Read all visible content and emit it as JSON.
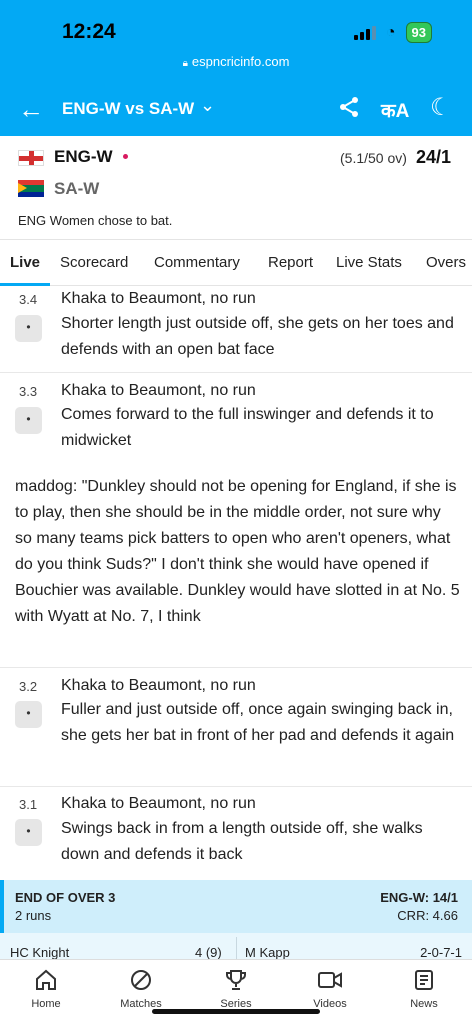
{
  "status": {
    "time": "12:24",
    "battery": "93"
  },
  "url": "espncricinfo.com",
  "header": {
    "title": "ENG-W vs SA-W"
  },
  "score": {
    "team1": "ENG-W",
    "team2": "SA-W",
    "overs": "(5.1/50 ov)",
    "runs": "24/1",
    "toss": "ENG Women chose to bat."
  },
  "tabs": [
    "Live",
    "Scorecard",
    "Commentary",
    "Report",
    "Live Stats",
    "Overs"
  ],
  "balls": [
    {
      "num": "3.4",
      "chip": "•",
      "head": "Khaka to Beaumont, no run",
      "text": "Shorter length just outside off, she gets on her toes and defends with an open bat face"
    },
    {
      "num": "3.3",
      "chip": "•",
      "head": "Khaka to Beaumont, no run",
      "text": "Comes forward to the full inswinger and defends it to midwicket"
    },
    {
      "num": "3.2",
      "chip": "•",
      "head": "Khaka to Beaumont, no run",
      "text": "Fuller and just outside off, once again swinging back in, she gets her bat in front of her pad and defends it again"
    },
    {
      "num": "3.1",
      "chip": "•",
      "head": "Khaka to Beaumont, no run",
      "text": "Swings back in from a length outside off, she walks down and defends it back"
    }
  ],
  "note": "maddog: \"Dunkley should not be opening for England, if she is to play, then she should be in the middle order, not sure why so many teams pick batters to open who aren't openers, what do you think Suds?\" I don't think she would have opened if Bouchier was available. Dunkley would have slotted in at No. 5 with Wyatt at No. 7, I think",
  "over": {
    "title": "END OF OVER 3",
    "runs": "2 runs",
    "score": "ENG-W: 14/1",
    "crr": "CRR: 4.66",
    "batter": "HC Knight",
    "batter_fig": "4 (9)",
    "bowler": "M Kapp",
    "bowler_fig": "2-0-7-1"
  },
  "nav": [
    {
      "label": "Home",
      "icon": "home-icon"
    },
    {
      "label": "Matches",
      "icon": "ball-icon"
    },
    {
      "label": "Series",
      "icon": "trophy-icon"
    },
    {
      "label": "Videos",
      "icon": "video-icon"
    },
    {
      "label": "News",
      "icon": "news-icon"
    }
  ],
  "colors": {
    "accent": "#03a9f4",
    "over_bg": "#cfeefb"
  }
}
